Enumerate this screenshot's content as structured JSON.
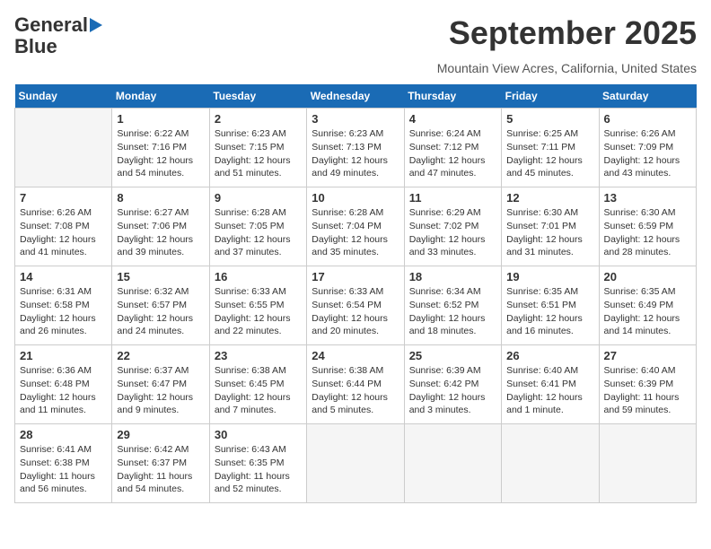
{
  "header": {
    "logo_line1": "General",
    "logo_line2": "Blue",
    "month": "September 2025",
    "location": "Mountain View Acres, California, United States"
  },
  "calendar": {
    "days_of_week": [
      "Sunday",
      "Monday",
      "Tuesday",
      "Wednesday",
      "Thursday",
      "Friday",
      "Saturday"
    ],
    "weeks": [
      [
        {
          "day": "",
          "info": ""
        },
        {
          "day": "1",
          "info": "Sunrise: 6:22 AM\nSunset: 7:16 PM\nDaylight: 12 hours\nand 54 minutes."
        },
        {
          "day": "2",
          "info": "Sunrise: 6:23 AM\nSunset: 7:15 PM\nDaylight: 12 hours\nand 51 minutes."
        },
        {
          "day": "3",
          "info": "Sunrise: 6:23 AM\nSunset: 7:13 PM\nDaylight: 12 hours\nand 49 minutes."
        },
        {
          "day": "4",
          "info": "Sunrise: 6:24 AM\nSunset: 7:12 PM\nDaylight: 12 hours\nand 47 minutes."
        },
        {
          "day": "5",
          "info": "Sunrise: 6:25 AM\nSunset: 7:11 PM\nDaylight: 12 hours\nand 45 minutes."
        },
        {
          "day": "6",
          "info": "Sunrise: 6:26 AM\nSunset: 7:09 PM\nDaylight: 12 hours\nand 43 minutes."
        }
      ],
      [
        {
          "day": "7",
          "info": "Sunrise: 6:26 AM\nSunset: 7:08 PM\nDaylight: 12 hours\nand 41 minutes."
        },
        {
          "day": "8",
          "info": "Sunrise: 6:27 AM\nSunset: 7:06 PM\nDaylight: 12 hours\nand 39 minutes."
        },
        {
          "day": "9",
          "info": "Sunrise: 6:28 AM\nSunset: 7:05 PM\nDaylight: 12 hours\nand 37 minutes."
        },
        {
          "day": "10",
          "info": "Sunrise: 6:28 AM\nSunset: 7:04 PM\nDaylight: 12 hours\nand 35 minutes."
        },
        {
          "day": "11",
          "info": "Sunrise: 6:29 AM\nSunset: 7:02 PM\nDaylight: 12 hours\nand 33 minutes."
        },
        {
          "day": "12",
          "info": "Sunrise: 6:30 AM\nSunset: 7:01 PM\nDaylight: 12 hours\nand 31 minutes."
        },
        {
          "day": "13",
          "info": "Sunrise: 6:30 AM\nSunset: 6:59 PM\nDaylight: 12 hours\nand 28 minutes."
        }
      ],
      [
        {
          "day": "14",
          "info": "Sunrise: 6:31 AM\nSunset: 6:58 PM\nDaylight: 12 hours\nand 26 minutes."
        },
        {
          "day": "15",
          "info": "Sunrise: 6:32 AM\nSunset: 6:57 PM\nDaylight: 12 hours\nand 24 minutes."
        },
        {
          "day": "16",
          "info": "Sunrise: 6:33 AM\nSunset: 6:55 PM\nDaylight: 12 hours\nand 22 minutes."
        },
        {
          "day": "17",
          "info": "Sunrise: 6:33 AM\nSunset: 6:54 PM\nDaylight: 12 hours\nand 20 minutes."
        },
        {
          "day": "18",
          "info": "Sunrise: 6:34 AM\nSunset: 6:52 PM\nDaylight: 12 hours\nand 18 minutes."
        },
        {
          "day": "19",
          "info": "Sunrise: 6:35 AM\nSunset: 6:51 PM\nDaylight: 12 hours\nand 16 minutes."
        },
        {
          "day": "20",
          "info": "Sunrise: 6:35 AM\nSunset: 6:49 PM\nDaylight: 12 hours\nand 14 minutes."
        }
      ],
      [
        {
          "day": "21",
          "info": "Sunrise: 6:36 AM\nSunset: 6:48 PM\nDaylight: 12 hours\nand 11 minutes."
        },
        {
          "day": "22",
          "info": "Sunrise: 6:37 AM\nSunset: 6:47 PM\nDaylight: 12 hours\nand 9 minutes."
        },
        {
          "day": "23",
          "info": "Sunrise: 6:38 AM\nSunset: 6:45 PM\nDaylight: 12 hours\nand 7 minutes."
        },
        {
          "day": "24",
          "info": "Sunrise: 6:38 AM\nSunset: 6:44 PM\nDaylight: 12 hours\nand 5 minutes."
        },
        {
          "day": "25",
          "info": "Sunrise: 6:39 AM\nSunset: 6:42 PM\nDaylight: 12 hours\nand 3 minutes."
        },
        {
          "day": "26",
          "info": "Sunrise: 6:40 AM\nSunset: 6:41 PM\nDaylight: 12 hours\nand 1 minute."
        },
        {
          "day": "27",
          "info": "Sunrise: 6:40 AM\nSunset: 6:39 PM\nDaylight: 11 hours\nand 59 minutes."
        }
      ],
      [
        {
          "day": "28",
          "info": "Sunrise: 6:41 AM\nSunset: 6:38 PM\nDaylight: 11 hours\nand 56 minutes."
        },
        {
          "day": "29",
          "info": "Sunrise: 6:42 AM\nSunset: 6:37 PM\nDaylight: 11 hours\nand 54 minutes."
        },
        {
          "day": "30",
          "info": "Sunrise: 6:43 AM\nSunset: 6:35 PM\nDaylight: 11 hours\nand 52 minutes."
        },
        {
          "day": "",
          "info": ""
        },
        {
          "day": "",
          "info": ""
        },
        {
          "day": "",
          "info": ""
        },
        {
          "day": "",
          "info": ""
        }
      ]
    ]
  }
}
